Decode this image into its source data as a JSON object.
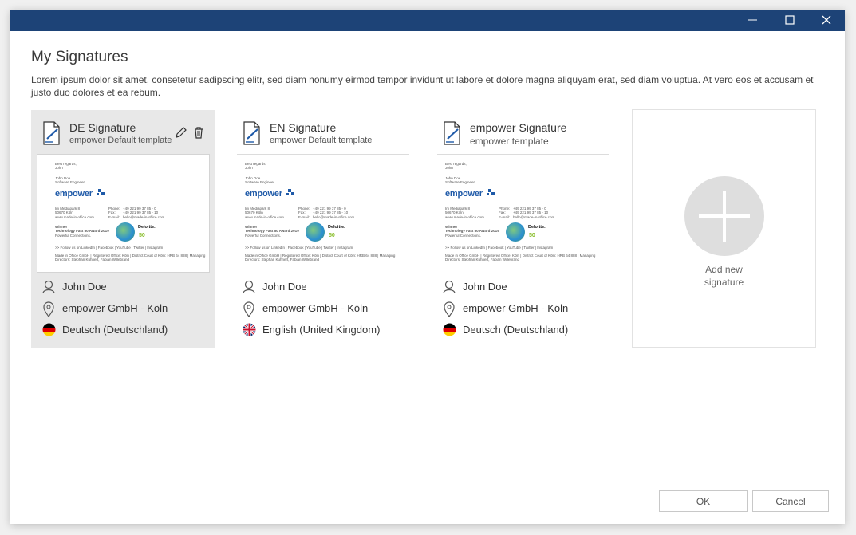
{
  "window": {
    "title_bar_color": "#1d4377",
    "controls": [
      "minimize-icon",
      "maximize-icon",
      "close-icon"
    ]
  },
  "page": {
    "title": "My Signatures",
    "description": "Lorem ipsum dolor sit amet, consetetur sadipscing elitr, sed diam nonumy eirmod tempor invidunt ut labore et dolore magna aliquyam erat, sed diam voluptua. At vero eos et accusam et justo duo dolores et ea rebum."
  },
  "preview": {
    "greeting": "Best regards,",
    "first": "John",
    "name": "John Doe",
    "role": "Software Engineer",
    "logo": "empower",
    "addr1": "Im Mediapark 8",
    "addr2": "50670 Köln",
    "site": "www.made-in-office.com",
    "phone_lbl": "Phone:",
    "phone": "+49 221 99 37 85 - 0",
    "fax_lbl": "Fax:",
    "fax": "+49 221 99 37 85 - 10",
    "mail_lbl": "E-mail:",
    "mail": "hello@made-in-office.com",
    "award1": "Winner",
    "award2": "Technology Fast 50 Award 2019",
    "award3": "Powerful Connections.",
    "deloitte": "Deloitte.",
    "fifty": "50",
    "follow": ">> Follow us on LinkedIn | Facebook | YouTube | Twitter | Instagram",
    "legal1": "Made in Office GmbH | Registered Office: Köln | District Court of Köln: HRB 64 888 | Managing",
    "legal2": "Directors: Stephan Kuhnert, Fabian Willebrand"
  },
  "signatures": [
    {
      "title": "DE Signature",
      "subtitle": "empower Default template",
      "user": "John Doe",
      "location": "empower GmbH - Köln",
      "language": "Deutsch (Deutschland)",
      "flag": "de-flag-icon",
      "selected": true
    },
    {
      "title": "EN Signature",
      "subtitle": "empower Default template",
      "user": "John Doe",
      "location": "empower GmbH - Köln",
      "language": "English (United Kingdom)",
      "flag": "uk-flag-icon",
      "selected": false
    },
    {
      "title": "empower Signature",
      "subtitle": "empower template",
      "user": "John Doe",
      "location": "empower GmbH - Köln",
      "language": "Deutsch (Deutschland)",
      "flag": "de-flag-icon",
      "selected": false
    }
  ],
  "add_card": {
    "label_line1": "Add new",
    "label_line2": "signature"
  },
  "footer": {
    "ok_label": "OK",
    "cancel_label": "Cancel"
  }
}
